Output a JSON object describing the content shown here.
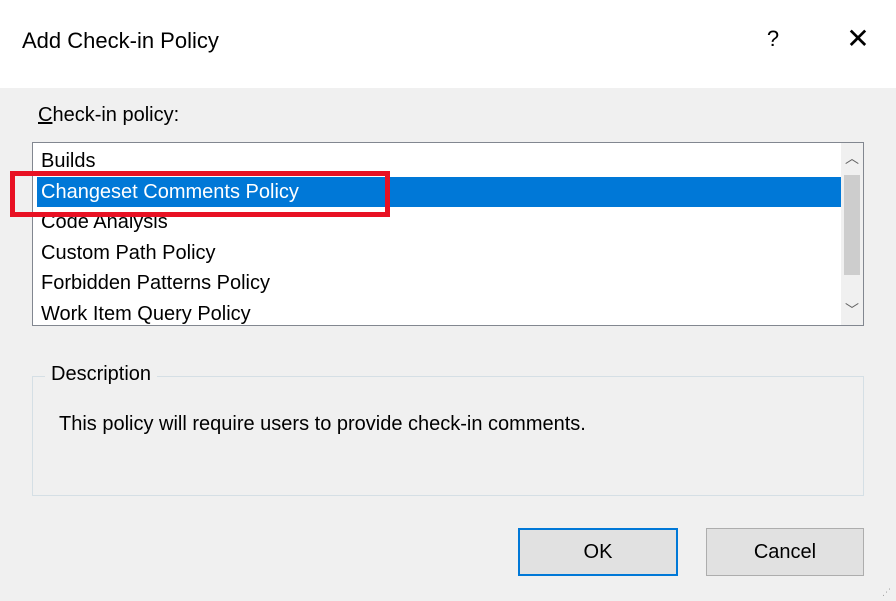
{
  "window": {
    "title": "Add Check-in Policy",
    "help_glyph": "?",
    "close_glyph": "✕"
  },
  "policy_list": {
    "label_accel": "C",
    "label_rest": "heck-in policy:",
    "items": [
      {
        "label": "Builds",
        "selected": false
      },
      {
        "label": "Changeset Comments Policy",
        "selected": true
      },
      {
        "label": "Code Analysis",
        "selected": false
      },
      {
        "label": "Custom Path Policy",
        "selected": false
      },
      {
        "label": "Forbidden Patterns Policy",
        "selected": false
      },
      {
        "label": "Work Item Query Policy",
        "selected": false
      }
    ],
    "scroll_up_glyph": "︿",
    "scroll_down_glyph": "﹀"
  },
  "description": {
    "group_title": "Description",
    "text": "This policy will require users to provide check-in comments."
  },
  "buttons": {
    "ok": "OK",
    "cancel": "Cancel"
  },
  "colors": {
    "selection": "#0078d7",
    "highlight_box": "#e81123",
    "dialog_bg": "#f0f0f0"
  }
}
